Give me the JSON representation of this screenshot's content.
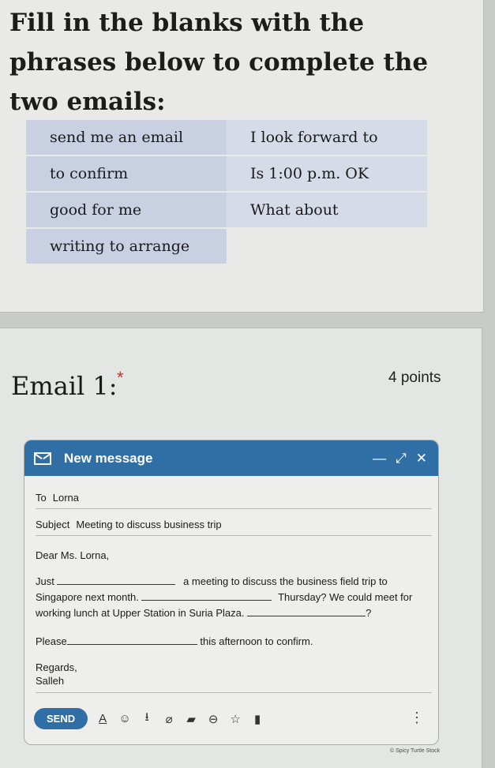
{
  "instructions": "Fill in the blanks with the phrases below to complete the two emails:",
  "phrases": {
    "rows": [
      [
        "send me an email",
        "I look forward to"
      ],
      [
        "to confirm",
        "Is 1:00 p.m. OK"
      ],
      [
        "good for me",
        "What about"
      ],
      [
        "writing to arrange",
        ""
      ]
    ]
  },
  "question": {
    "title": "Email 1:",
    "required_mark": "*",
    "points": "4 points"
  },
  "email": {
    "window_title": "New message",
    "controls": {
      "minimize": "—",
      "expand": "⤢",
      "close": "✕"
    },
    "to_label": "To",
    "to_value": "Lorna",
    "subject_label": "Subject",
    "subject_value": "Meeting to discuss business trip",
    "greeting": "Dear Ms. Lorna,",
    "p1_a": "Just",
    "p1_b": "a meeting to discuss the business field trip to",
    "p1_c": "Singapore next month.",
    "p1_d": "Thursday? We could meet for",
    "p1_e": "working lunch at Upper Station in Suria Plaza.",
    "p1_f": "?",
    "p2_a": "Please",
    "p2_b": "this afternoon to confirm.",
    "closing": "Regards,",
    "signature": "Salleh",
    "send_label": "SEND",
    "tools": [
      "format-icon",
      "emoji-icon",
      "attach-drive-icon",
      "attach-file-icon",
      "image-icon",
      "link-icon",
      "star-icon",
      "trash-icon"
    ],
    "more": "⋮"
  },
  "watermark": "© Spicy Turtle Stock"
}
